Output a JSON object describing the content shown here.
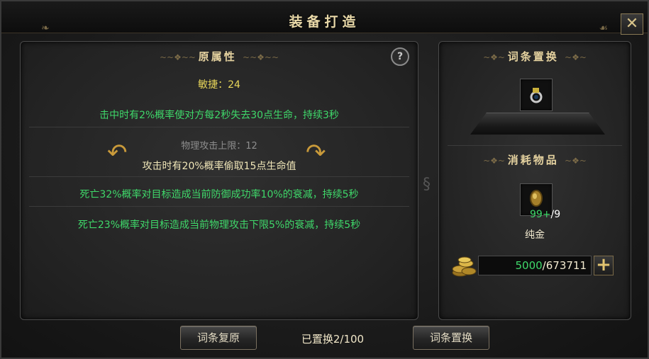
{
  "window": {
    "title": "装备打造",
    "close_glyph": "✕"
  },
  "left_panel": {
    "section_title": "原属性",
    "help_glyph": "?",
    "attributes": [
      {
        "text": "敏捷：24",
        "color": "#e8d65a"
      },
      {
        "text": "击中时有2%概率使对方每2秒失去30点生命，持续3秒",
        "color": "#3fd86a"
      },
      {
        "text": "物理攻击上限：12",
        "color": "#8e8e8e"
      },
      {
        "text": "攻击时有20%概率偷取15点生命值",
        "color": "#f0e6b8"
      },
      {
        "text": "死亡32%概率对目标造成当前防御成功率10%的衰减，持续5秒",
        "color": "#3fd86a"
      },
      {
        "text": "死亡23%概率对目标造成当前物理攻击下限5%的衰减，持续5秒",
        "color": "#3fd86a"
      }
    ]
  },
  "right_panel": {
    "replace_section_title": "词条置换",
    "equipped_item_icon": "ring-icon",
    "consumables_section_title": "消耗物品",
    "consumable": {
      "icon": "gold-nugget-icon",
      "have": "99+",
      "need": "/9",
      "name": "纯金"
    },
    "currency": {
      "icon": "gold-coins-icon",
      "cost": "5000",
      "total": "/673711",
      "add_glyph": "+"
    }
  },
  "footer": {
    "restore_button": "词条复原",
    "status": "已置换2/100",
    "replace_button": "词条置换"
  },
  "colors": {
    "accent_gold": "#e6d3a0",
    "green_stat": "#3fd86a",
    "yellow_stat": "#e8d65a"
  }
}
